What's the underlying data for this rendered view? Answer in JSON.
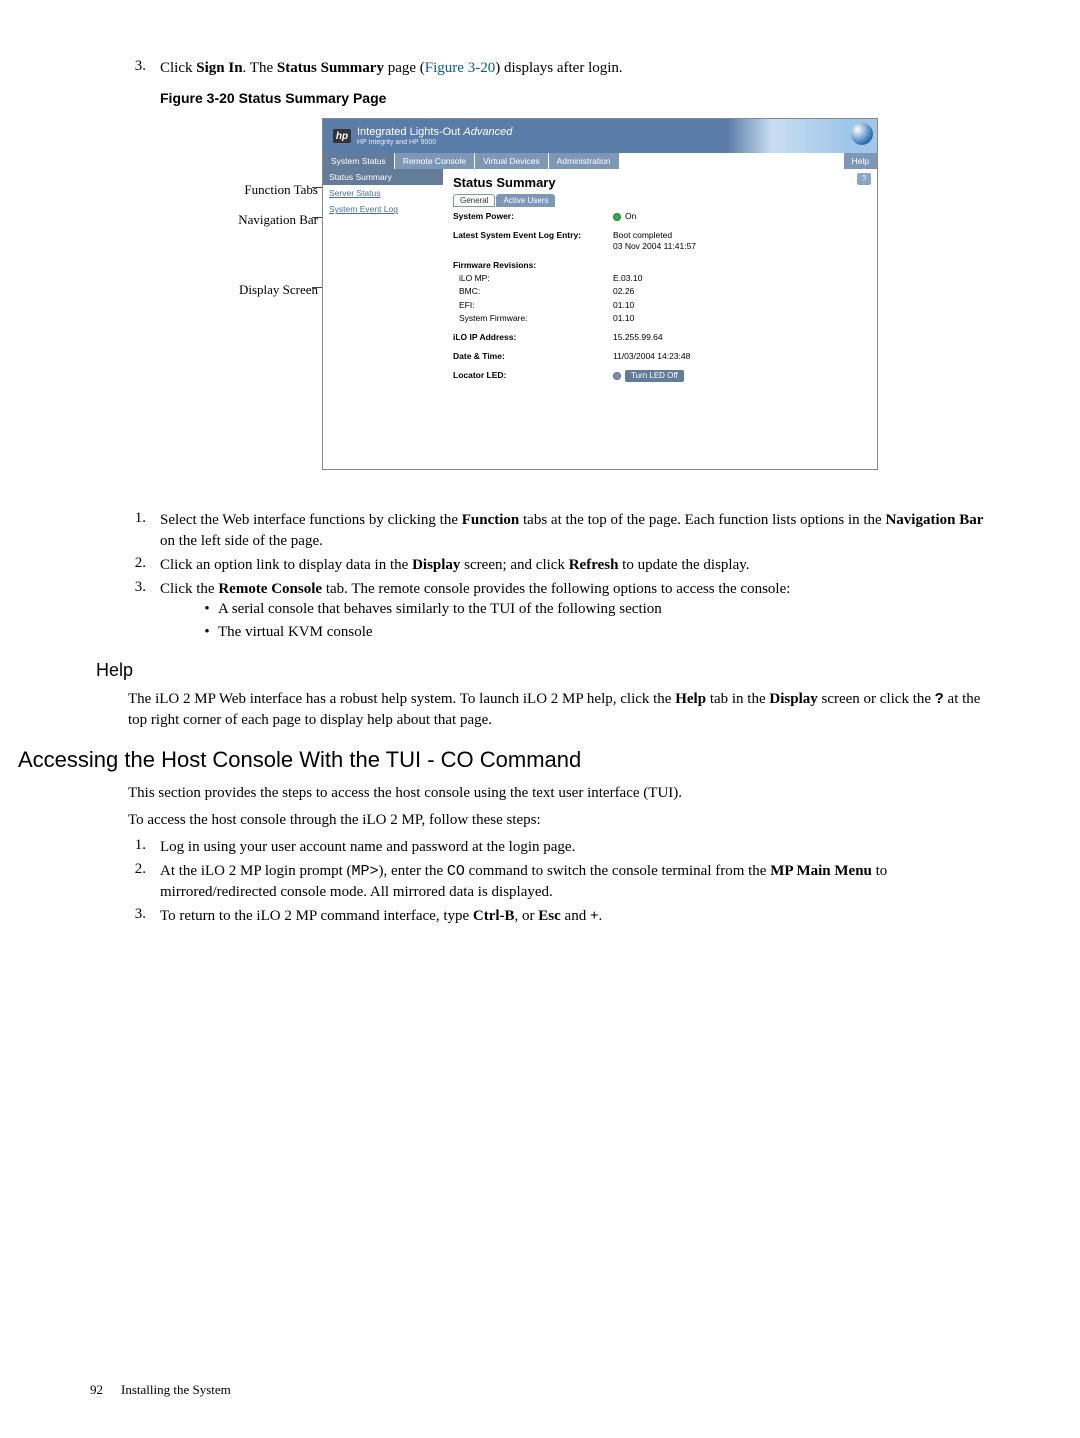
{
  "step3_pre": "Click ",
  "step3_sign": "Sign In",
  "step3_mid": ". The ",
  "step3_ss": "Status Summary",
  "step3_post1": " page (",
  "step3_figref": "Figure 3-20",
  "step3_post2": ") displays after login.",
  "fig_caption": "Figure 3-20  Status Summary Page",
  "callouts": {
    "c1": "Function Tabs",
    "c2": "Navigation Bar",
    "c3": "Display Screen"
  },
  "banner": {
    "title_a": "Integrated Lights-Out ",
    "title_b": "Advanced",
    "sub": "HP Integrity and HP 9000",
    "badge": "hp"
  },
  "tabs": [
    "System Status",
    "Remote Console",
    "Virtual Devices",
    "Administration",
    "Help"
  ],
  "sidebar": [
    "Status Summary",
    "Server Status",
    "System Event Log"
  ],
  "display": {
    "title": "Status Summary",
    "subtabs": [
      "General",
      "Active Users"
    ],
    "rows": {
      "syspower_l": "System Power:",
      "syspower_v": "On",
      "lastlog_l": "Latest System Event Log Entry:",
      "lastlog_v1": "Boot completed",
      "lastlog_v2": "03 Nov 2004 11:41:57",
      "fwrev": "Firmware Revisions:",
      "fw_mp_l": "iLO MP:",
      "fw_mp_v": "E.03.10",
      "fw_bmc_l": "BMC:",
      "fw_bmc_v": "02.26",
      "fw_efi_l": "EFI:",
      "fw_efi_v": "01.10",
      "fw_sys_l": "System Firmware:",
      "fw_sys_v": "01.10",
      "ip_l": "iLO IP Address:",
      "ip_v": "15.255.99.64",
      "dt_l": "Date & Time:",
      "dt_v": "11/03/2004 14:23:48",
      "led_l": "Locator LED:",
      "led_btn": "Turn LED Off"
    }
  },
  "steps_b": {
    "s1a": "Select the Web interface functions by clicking the ",
    "s1b": "Function",
    "s1c": " tabs at the top of the page. Each function lists options in the ",
    "s1d": "Navigation Bar",
    "s1e": " on the left side of the page.",
    "s2a": "Click an option link to display data in the ",
    "s2b": "Display",
    "s2c": " screen; and click ",
    "s2d": "Refresh",
    "s2e": " to update the display.",
    "s3a": "Click the ",
    "s3b": "Remote Console",
    "s3c": " tab. The remote console provides the following options to access the console:",
    "s3_b1": "A serial console that behaves similarly to the TUI of the following section",
    "s3_b2": "The virtual KVM console"
  },
  "help_h": "Help",
  "help_p_a": "The iLO 2 MP Web interface has a robust help system. To launch iLO 2 MP help, click the ",
  "help_p_b": "Help",
  "help_p_c": " tab in the ",
  "help_p_d": "Display",
  "help_p_e": " screen or click the ",
  "help_p_f": "?",
  "help_p_g": " at the top right corner of each page to display help about that page.",
  "sec_h": "Accessing the Host Console With the TUI - CO Command",
  "sec_p1": "This section provides the steps to access the host console using the text user interface (TUI).",
  "sec_p2": "To access the host console through the iLO 2 MP, follow these steps:",
  "steps_c": {
    "s1": "Log in using your user account name and password at the login page.",
    "s2a": "At the iLO 2 MP login prompt (",
    "s2b": "MP>",
    "s2c": "), enter the ",
    "s2d": "CO",
    "s2e": " command to switch the console terminal from the ",
    "s2f": "MP Main Menu",
    "s2g": " to mirrored/redirected console mode. All mirrored data is displayed.",
    "s3a": "To return to the iLO 2 MP command interface, type ",
    "s3b": "Ctrl-B",
    "s3c": ", or ",
    "s3d": "Esc",
    "s3e": " and ",
    "s3f": "+",
    "s3g": "."
  },
  "footer_page": "92",
  "footer_text": "Installing the System"
}
